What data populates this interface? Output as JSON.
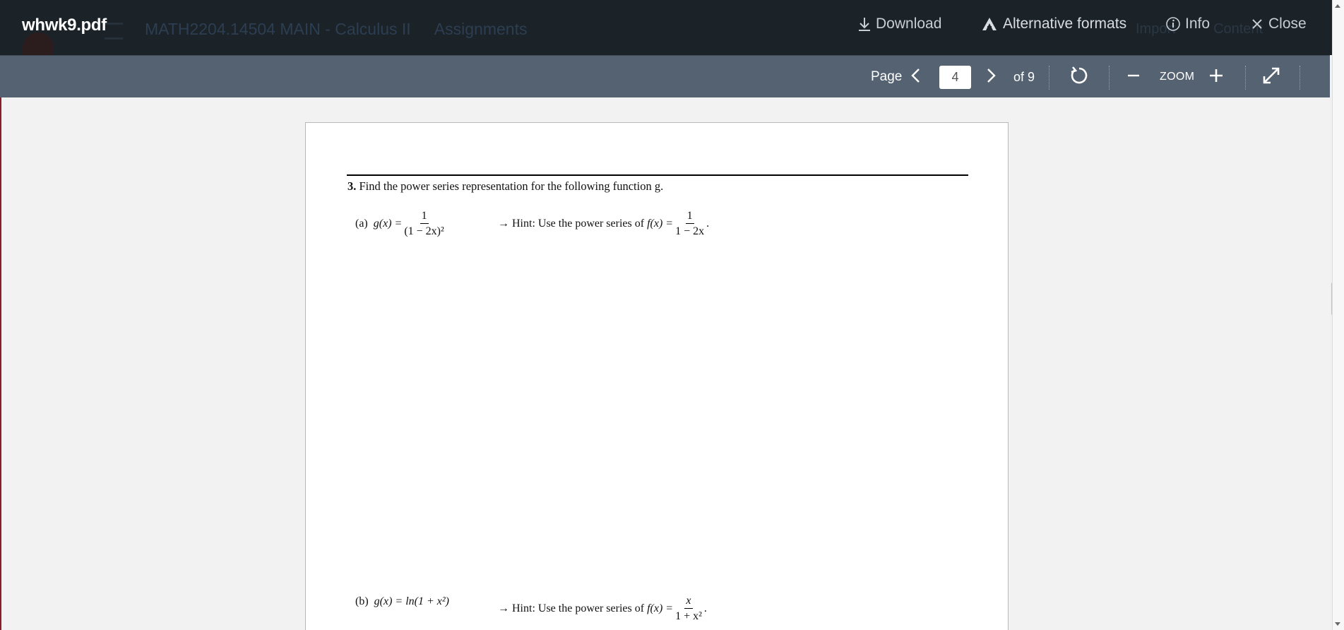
{
  "header": {
    "filename": "whwk9.pdf",
    "ghost_course": "MATH2204.14504 MAIN - Calculus II",
    "ghost_section": "Assignments",
    "ghost_right_1": "Import",
    "ghost_right_2": "Content",
    "actions": {
      "download": "Download",
      "alternative_formats": "Alternative formats",
      "info": "Info",
      "close": "Close"
    }
  },
  "toolbar": {
    "page_label": "Page",
    "current_page": "4",
    "total_pages": "of 9",
    "zoom_label": "ZOOM"
  },
  "document": {
    "problem_number": "3.",
    "problem_text": "Find the power series representation for the following function g.",
    "part_a": {
      "label": "(a)",
      "lhs": "g(x) =",
      "numerator": "1",
      "denominator": "(1 − 2x)²",
      "hint_prefix": "→ Hint: Use the power series of",
      "hint_lhs": "f(x) =",
      "hint_numerator": "1",
      "hint_denominator": "1 − 2x",
      "hint_end": "."
    },
    "part_b": {
      "label": "(b)",
      "expression": "g(x) = ln(1 + x²)",
      "hint_prefix": "→ Hint: Use the power series of",
      "hint_lhs": "f(x) =",
      "hint_numerator": "x",
      "hint_denominator": "1 + x²",
      "hint_end": "."
    }
  },
  "colors": {
    "header_bg": "#1b2228",
    "toolbar_bg": "#556271",
    "viewer_bg": "#f2f2f2"
  }
}
